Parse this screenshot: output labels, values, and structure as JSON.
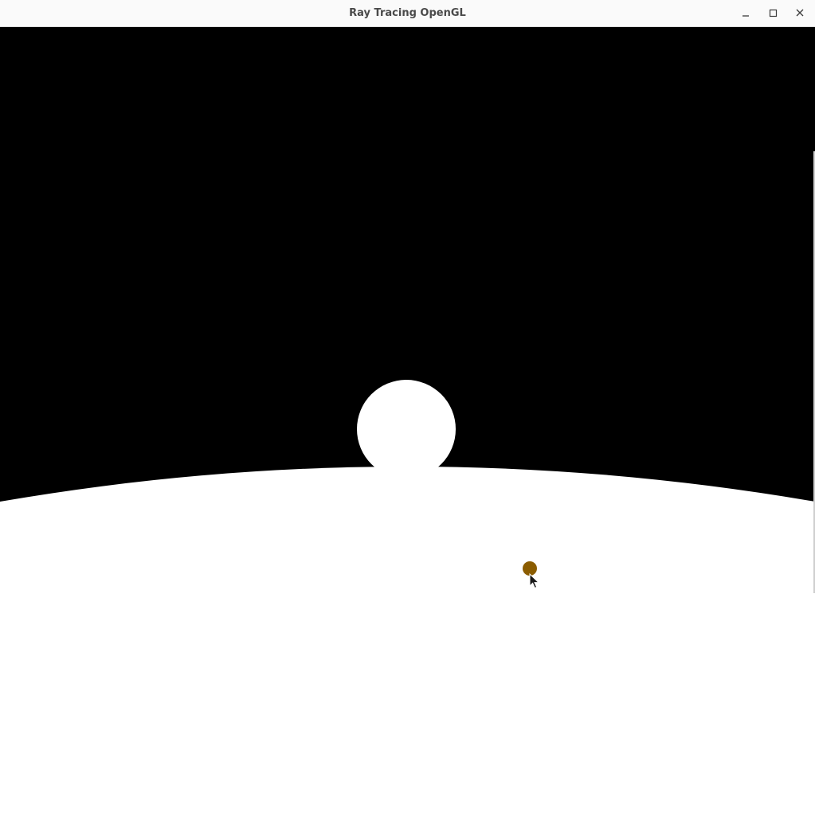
{
  "window": {
    "title": "Ray Tracing OpenGL"
  },
  "controls": {
    "minimize_icon": "minimize-icon",
    "maximize_icon": "maximize-icon",
    "close_icon": "close-icon"
  },
  "scene": {
    "sky_color": "#000000",
    "ground_color": "#ffffff",
    "sphere_color": "#ffffff",
    "light_marker_color": "#8b5c00"
  },
  "cursor": {
    "icon": "arrow-cursor-icon"
  }
}
